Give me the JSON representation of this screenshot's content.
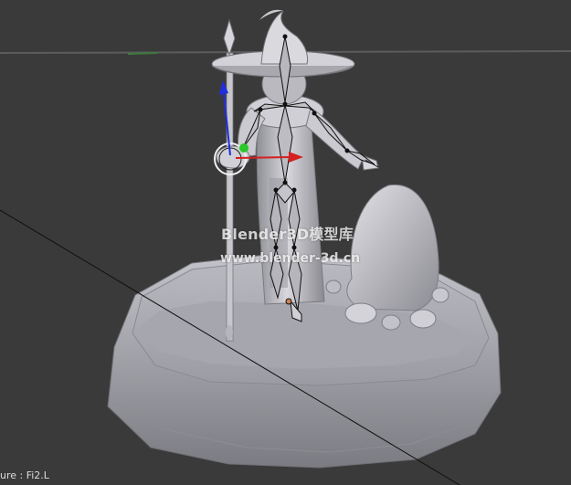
{
  "viewport": {
    "background_color": "#3a3a3a",
    "selected_object_text": "ure : Fi2.L"
  },
  "watermark": {
    "title": "Blender3D模型库",
    "url": "www.blender-3d.cn"
  },
  "scene": {
    "objects": [
      "wizard-figure",
      "wizard-hat",
      "staff",
      "armature",
      "rock",
      "pebbles",
      "pedestal-base"
    ],
    "manipulator": {
      "axes": [
        "x-axis",
        "y-axis",
        "z-axis"
      ],
      "colors": {
        "x": "#d42020",
        "y": "#29c829",
        "z": "#1f2ee0"
      }
    },
    "colors": {
      "grid_line": "#5a5a5a",
      "model_light": "#c6c6cc",
      "model_dark": "#7d7d83",
      "bone_line": "#111111"
    }
  }
}
